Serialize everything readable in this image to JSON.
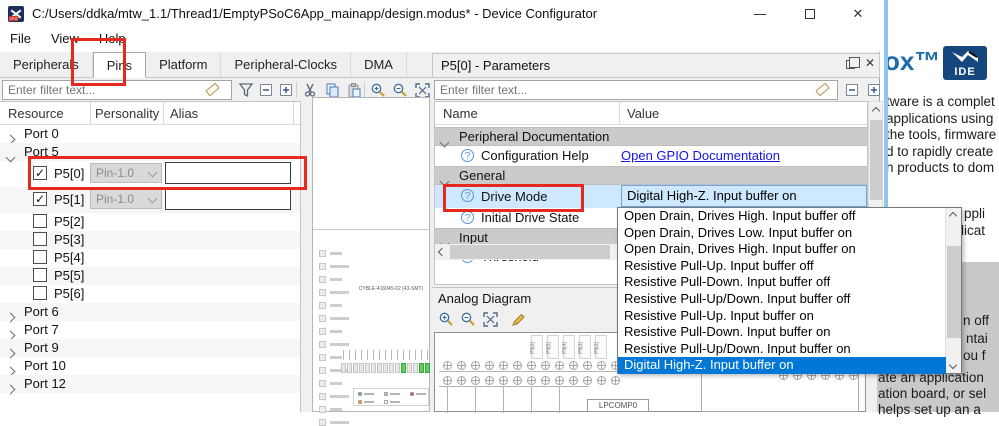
{
  "window": {
    "title": "C:/Users/ddka/mtw_1.1/Thread1/EmptyPSoC6App_mainapp/design.modus* - Device Configurator",
    "controls": [
      "minimize",
      "maximize",
      "close"
    ]
  },
  "menu": {
    "items": [
      "File",
      "View",
      "Help"
    ]
  },
  "tabs": {
    "items": [
      "Peripherals",
      "Pins",
      "Platform",
      "Peripheral-Clocks",
      "DMA"
    ],
    "active": "Pins"
  },
  "left_toolbar": {
    "filter_placeholder": "Enter filter text...",
    "icons": [
      "eraser",
      "filter-funnel",
      "collapse-all",
      "expand-all",
      "cut",
      "copy",
      "paste",
      "zoom-in",
      "zoom-out",
      "zoom-fit"
    ]
  },
  "resource_tree": {
    "columns": [
      "Resource",
      "Personality",
      "Alias"
    ],
    "rows": [
      {
        "type": "port",
        "label": "Port 0",
        "expanded": false
      },
      {
        "type": "port",
        "label": "Port 5",
        "expanded": true
      },
      {
        "type": "pin",
        "label": "P5[0]",
        "checked": true,
        "personality": "Pin-1.0",
        "alias": "",
        "tall": true
      },
      {
        "type": "pin",
        "label": "P5[1]",
        "checked": true,
        "personality": "Pin-1.0",
        "alias": "",
        "tall": true
      },
      {
        "type": "pin",
        "label": "P5[2]",
        "checked": false
      },
      {
        "type": "pin",
        "label": "P5[3]",
        "checked": false
      },
      {
        "type": "pin",
        "label": "P5[4]",
        "checked": false
      },
      {
        "type": "pin",
        "label": "P5[5]",
        "checked": false
      },
      {
        "type": "pin",
        "label": "P5[6]",
        "checked": false
      },
      {
        "type": "port",
        "label": "Port 6",
        "expanded": false
      },
      {
        "type": "port",
        "label": "Port 7",
        "expanded": false
      },
      {
        "type": "port",
        "label": "Port 9",
        "expanded": false
      },
      {
        "type": "port",
        "label": "Port 10",
        "expanded": false
      },
      {
        "type": "port",
        "label": "Port 12",
        "expanded": false
      }
    ]
  },
  "package_panel": {
    "chip_label": "CYBLE-416045-02 (43-SMT)",
    "legend_colors": [
      "#4caf50",
      "#bdbdbd",
      "#e53935",
      "#ff9800",
      "#ffffff"
    ]
  },
  "params_panel": {
    "title": "P5[0] - Parameters",
    "filter_placeholder": "Enter filter text...",
    "columns": [
      "Name",
      "Value"
    ],
    "rows": [
      {
        "type": "group",
        "label": "Peripheral Documentation"
      },
      {
        "type": "param",
        "label": "Configuration Help",
        "value": "Open GPIO Documentation",
        "value_type": "link"
      },
      {
        "type": "group",
        "label": "General"
      },
      {
        "type": "param",
        "label": "Drive Mode",
        "value": "Digital High-Z. Input buffer on",
        "selected": true,
        "combo": true
      },
      {
        "type": "param",
        "label": "Initial Drive State",
        "value": ""
      },
      {
        "type": "group",
        "label": "Input"
      },
      {
        "type": "param",
        "label": "Threshold",
        "value": ""
      }
    ]
  },
  "drive_mode_dropdown": {
    "selected": "Digital High-Z. Input buffer on",
    "options": [
      "Open Drain, Drives High. Input buffer off",
      "Open Drain, Drives Low. Input buffer on",
      "Open Drain, Drives High. Input buffer on",
      "Resistive Pull-Up. Input buffer off",
      "Resistive Pull-Down. Input buffer off",
      "Resistive Pull-Up/Down. Input buffer off",
      "Resistive Pull-Up. Input buffer on",
      "Resistive Pull-Down. Input buffer on",
      "Resistive Pull-Up/Down. Input buffer on",
      "Digital High-Z. Input buffer on"
    ]
  },
  "analog_section": {
    "title": "Analog Diagram",
    "icons": [
      "zoom-in",
      "zoom-out",
      "zoom-fit",
      "edit-pencil"
    ],
    "block_label": "LPCOMP0",
    "pin_labels": [
      "P5[0]",
      "P5[5]",
      "P5[4]",
      "P5[3]",
      "P5[2]"
    ]
  },
  "background_doc": {
    "brand_fragment": "ox™",
    "ide_badge_label": "IDE",
    "paragraph_lines": [
      "tware is a complet",
      "applications using",
      "the tools, firmware",
      "d to rapidly create",
      "h products to dom"
    ],
    "side_fragments": [
      "ppli",
      "licat"
    ],
    "highlight_fragments": [
      "n off",
      "ntai",
      "ou f"
    ],
    "highlight_lines": [
      "ate an application",
      "ation board, or sel",
      "helps set up an a"
    ]
  },
  "colors": {
    "annotation_red": "#e5291f",
    "selection_blue": "#cde8ff",
    "dropdown_highlight": "#0078d7",
    "link_blue": "#1414e6",
    "group_row_gray": "#cbcbcb",
    "brand_blue": "#1d6cab"
  }
}
